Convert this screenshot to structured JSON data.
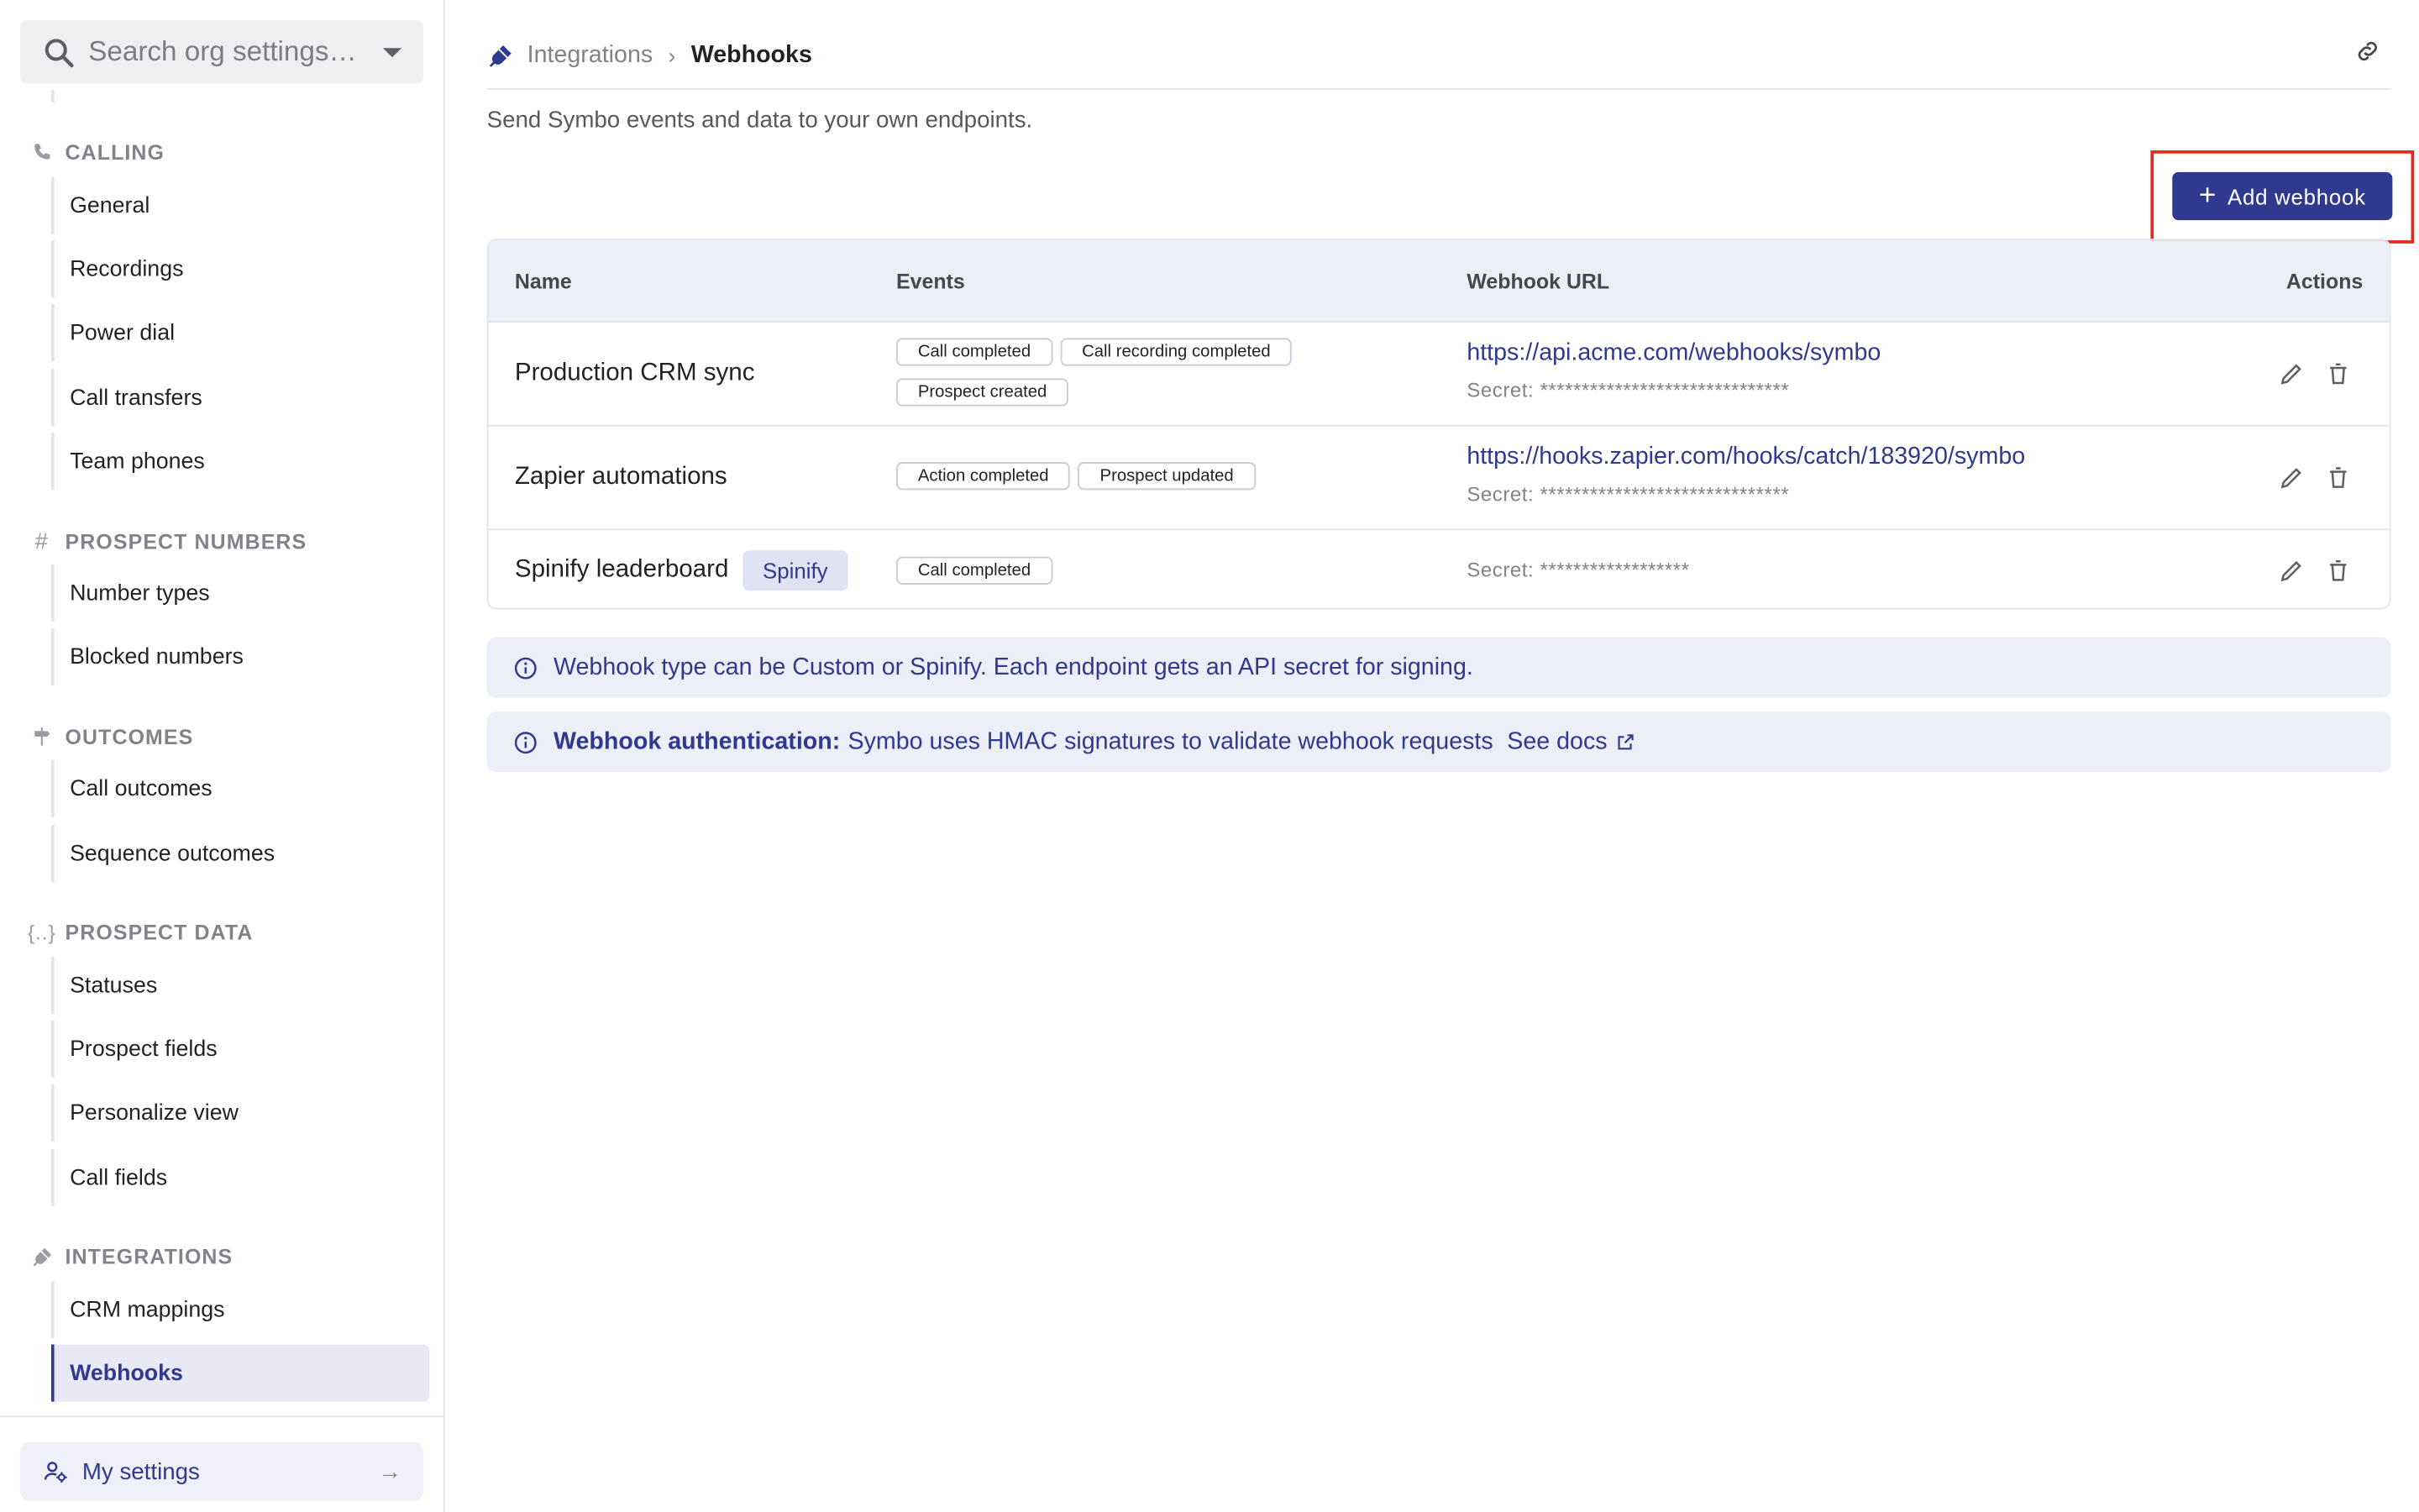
{
  "sidebar": {
    "search_placeholder": "Search org settings…",
    "sections": [
      {
        "title": "CALLING",
        "icon": "phone-icon"
      },
      {
        "title": "PROSPECT NUMBERS",
        "icon": "hash-icon"
      },
      {
        "title": "OUTCOMES",
        "icon": "signpost-icon"
      },
      {
        "title": "PROSPECT DATA",
        "icon": "braces-icon"
      },
      {
        "title": "INTEGRATIONS",
        "icon": "plug-icon"
      }
    ],
    "calling_items": [
      "General",
      "Recordings",
      "Power dial",
      "Call transfers",
      "Team phones"
    ],
    "numbers_items": [
      "Number types",
      "Blocked numbers"
    ],
    "outcomes_items": [
      "Call outcomes",
      "Sequence outcomes"
    ],
    "data_items": [
      "Statuses",
      "Prospect fields",
      "Personalize view",
      "Call fields"
    ],
    "integrations_items": [
      "CRM mappings",
      "Webhooks"
    ],
    "active_item": "Webhooks",
    "my_settings": "My settings"
  },
  "header": {
    "crumb_parent": "Integrations",
    "crumb_current": "Webhooks",
    "description": "Send Symbo events and data to your own endpoints.",
    "add_button": "Add webhook"
  },
  "table": {
    "columns": [
      "Name",
      "Events",
      "Webhook URL",
      "Actions"
    ],
    "rows": [
      {
        "name": "Production CRM sync",
        "events": [
          "Call completed",
          "Call recording completed",
          "Prospect created"
        ],
        "url": "https://api.acme.com/webhooks/symbo",
        "secret": "Secret: ******************************"
      },
      {
        "name": "Zapier automations",
        "events": [
          "Action completed",
          "Prospect updated"
        ],
        "url": "https://hooks.zapier.com/hooks/catch/183920/symbo",
        "secret": "Secret: ******************************"
      },
      {
        "name": "Spinify leaderboard",
        "badge": "Spinify",
        "events": [
          "Call completed"
        ],
        "url": "",
        "secret": "Secret: ******************"
      }
    ]
  },
  "banners": {
    "type_info": "Webhook type can be Custom or Spinify. Each endpoint gets an API secret for signing.",
    "auth_title": "Webhook authentication:",
    "auth_text": "Symbo uses HMAC signatures to validate webhook requests",
    "auth_link": "See docs"
  },
  "colors": {
    "accent": "#2f3a8f",
    "highlight_border": "#e6281f",
    "header_bg": "#eceef8"
  }
}
